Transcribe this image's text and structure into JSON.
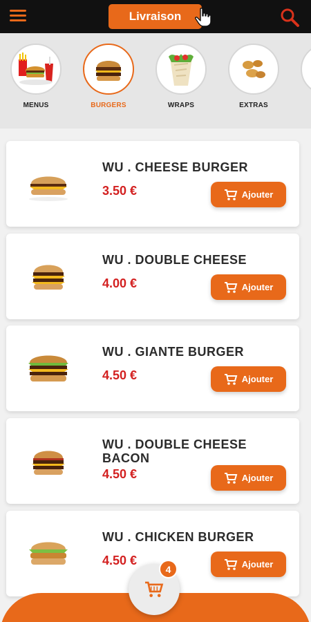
{
  "header": {
    "delivery_label": "Livraison"
  },
  "categories": [
    {
      "label": "MENUS",
      "icon": "menu-meal-icon",
      "active": false
    },
    {
      "label": "BURGERS",
      "icon": "burger-icon",
      "active": true
    },
    {
      "label": "WRAPS",
      "icon": "wrap-icon",
      "active": false
    },
    {
      "label": "EXTRAS",
      "icon": "nuggets-icon",
      "active": false
    },
    {
      "label": "D",
      "icon": "drink-icon",
      "active": false
    }
  ],
  "products": [
    {
      "name": "WU . CHEESE BURGER",
      "price": "3.50 €",
      "add_label": "Ajouter"
    },
    {
      "name": "WU . DOUBLE CHEESE",
      "price": "4.00 €",
      "add_label": "Ajouter"
    },
    {
      "name": "WU . GIANTE BURGER",
      "price": "4.50 €",
      "add_label": "Ajouter"
    },
    {
      "name": "WU . DOUBLE CHEESE BACON",
      "price": "4.50 €",
      "add_label": "Ajouter"
    },
    {
      "name": "WU . CHICKEN BURGER",
      "price": "4.50 €",
      "add_label": "Ajouter"
    }
  ],
  "cart": {
    "count": "4"
  },
  "colors": {
    "accent": "#e8691a",
    "price": "#d32020",
    "topbar": "#111111"
  }
}
